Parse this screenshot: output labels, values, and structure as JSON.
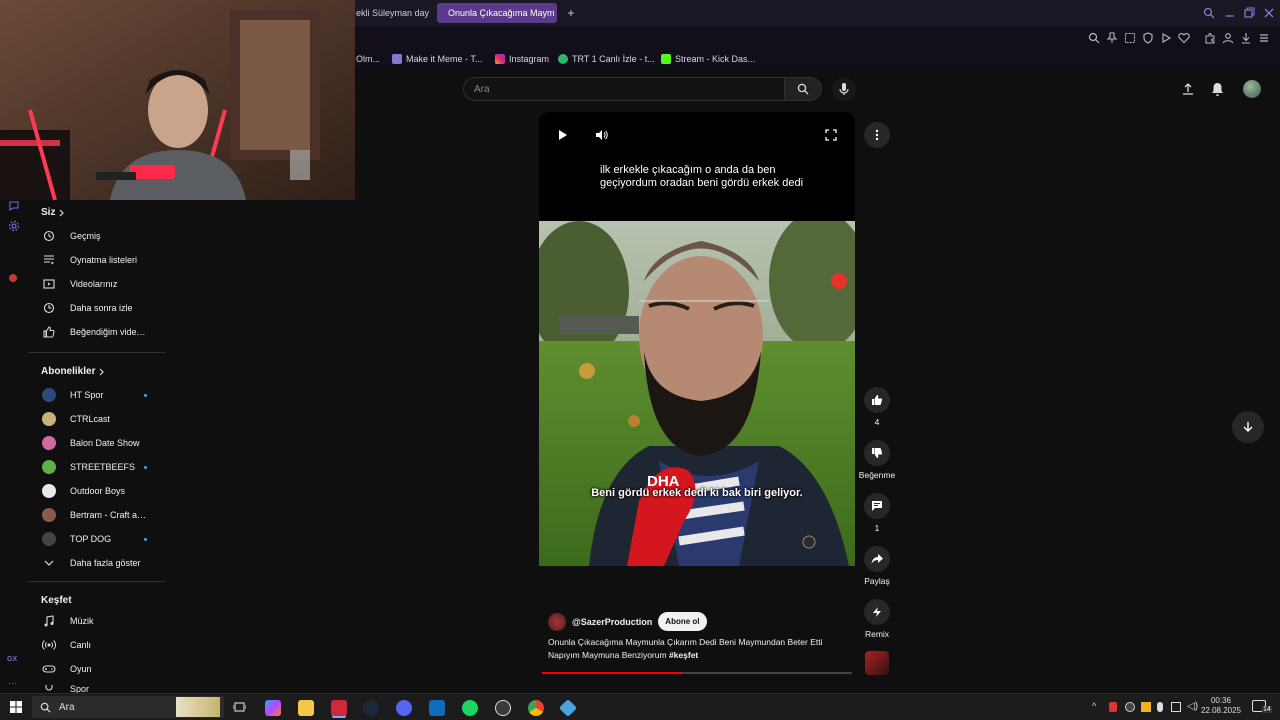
{
  "browser": {
    "tabs": [
      {
        "title": "ekli Süleyman day",
        "active": false
      },
      {
        "title": "Onunla Çıkacağıma Maym",
        "active": true
      }
    ],
    "new_tab": "+",
    "bookmarks": [
      {
        "label": "Olm...",
        "icon": "bookmark-icon"
      },
      {
        "label": "Make it Meme - T...",
        "icon": "mim-icon"
      },
      {
        "label": "Instagram",
        "icon": "instagram-icon"
      },
      {
        "label": "TRT 1 Canlı İzle - t...",
        "icon": "trt-icon"
      },
      {
        "label": "Stream - Kick Das...",
        "icon": "kick-icon"
      }
    ]
  },
  "header": {
    "search_placeholder": "Ara"
  },
  "sidebar": {
    "you_heading": "Siz",
    "you_items": [
      {
        "label": "Geçmiş",
        "icon": "history-icon"
      },
      {
        "label": "Oynatma listeleri",
        "icon": "playlist-icon"
      },
      {
        "label": "Videolarınız",
        "icon": "your-videos-icon"
      },
      {
        "label": "Daha sonra izle",
        "icon": "watch-later-icon"
      },
      {
        "label": "Beğendiğim videolar",
        "icon": "liked-icon"
      }
    ],
    "subs_heading": "Abonelikler",
    "subscriptions": [
      {
        "label": "HT Spor",
        "color": "#2d4a7a",
        "live": true
      },
      {
        "label": "CTRLcast",
        "color": "#c8b27a",
        "live": false
      },
      {
        "label": "Balon Date Show",
        "color": "#d26aa0",
        "live": false
      },
      {
        "label": "STREETBEEFS",
        "color": "#5fae4a",
        "live": true
      },
      {
        "label": "Outdoor Boys",
        "color": "#e8e8e8",
        "live": false
      },
      {
        "label": "Bertram - Craft and ...",
        "color": "#8a5a4a",
        "live": false
      },
      {
        "label": "TOP DOG",
        "color": "#444444",
        "live": true
      }
    ],
    "show_more": "Daha fazla göster",
    "explore_heading": "Keşfet",
    "explore_items": [
      {
        "label": "Müzik",
        "icon": "music-icon"
      },
      {
        "label": "Canlı",
        "icon": "live-icon"
      },
      {
        "label": "Oyun",
        "icon": "gaming-icon"
      },
      {
        "label": "Spor",
        "icon": "sports-icon"
      }
    ]
  },
  "player": {
    "top_caption": "ilk erkekle çıkacağım o anda da ben geçiyordum oradan beni gördü erkek dedi",
    "burned_caption": "Beni gördü erkek dedi ki bak biri geliyor.",
    "channel": "@SazerProduction",
    "subscribe_label": "Abone ol",
    "title": "Onunla Çıkacağıma Maymunla Çıkarım Dedi Beni Maymundan Beter Etti Napıyım Maymuna Benziyorum",
    "hashtag": "#keşfet",
    "progress": 0.45
  },
  "actions": {
    "like_count": "4",
    "dislike_label": "Beğenme",
    "comment_count": "1",
    "share_label": "Paylaş",
    "remix_label": "Remix"
  },
  "taskbar": {
    "search_placeholder": "Ara",
    "time": "00:36",
    "date": "22.08.2025",
    "notification_count": "14"
  }
}
